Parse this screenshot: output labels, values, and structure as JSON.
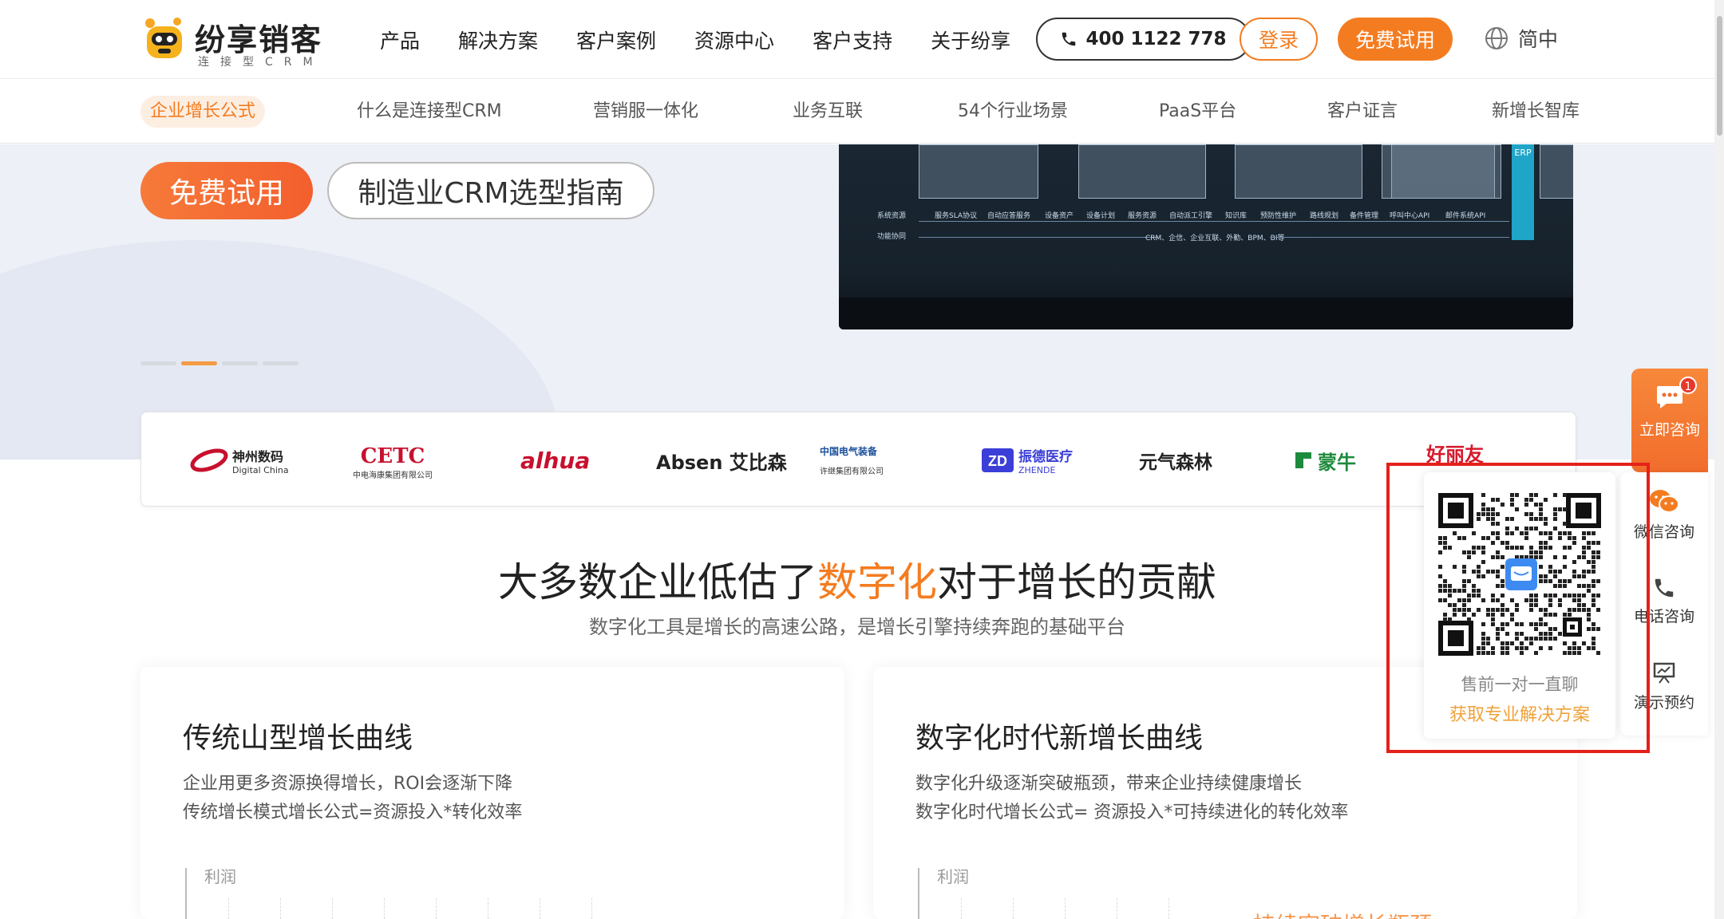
{
  "header": {
    "logo_text": "纷享销客",
    "logo_sub": "连接型CRM",
    "nav": [
      "产品",
      "解决方案",
      "客户案例",
      "资源中心",
      "客户支持",
      "关于纷享"
    ],
    "phone": "400 1122 778",
    "login": "登录",
    "trial": "免费试用",
    "lang": "简中"
  },
  "subnav": [
    "企业增长公式",
    "什么是连接型CRM",
    "营销服一体化",
    "业务互联",
    "54个行业场景",
    "PaaS平台",
    "客户证言",
    "新增长智库"
  ],
  "hero": {
    "trial_button": "免费试用",
    "guide_button": "制造业CRM选型指南",
    "image_labels": {
      "row1": "系统资源",
      "row2": "功能协同",
      "row2_center": "CRM、企信、企业互联、外勤、BPM、BI等",
      "erp": "ERP",
      "row1_items": [
        "服务SLA协议",
        "自动应答服务",
        "设备资产",
        "设备计划",
        "服务资源",
        "自动派工引擎",
        "知识库",
        "预防性维护",
        "路线规划",
        "备件管理",
        "呼叫中心API",
        "邮件系统API"
      ]
    }
  },
  "client_logos": [
    "神州数码",
    "Digital China",
    "CETC",
    "中电海康集团有限公司",
    "alhua",
    "Absen 艾比森",
    "中国电气装备",
    "许继集团有限公司",
    "振德医疗",
    "ZHENDE",
    "元气森林",
    "蒙牛",
    "好丽友"
  ],
  "section": {
    "title_before": "大多数企业低估了",
    "title_highlight": "数字化",
    "title_after": "对于增长的贡献",
    "subtitle": "数字化工具是增长的高速公路，是增长引擎持续奔跑的基础平台"
  },
  "cards": [
    {
      "title": "传统山型增长曲线",
      "line1": "企业用更多资源换得增长，ROI会逐渐下降",
      "line2": "传统增长模式增长公式=资源投入*转化效率",
      "axis_label": "利润"
    },
    {
      "title": "数字化时代新增长曲线",
      "line1": "数字化升级逐渐突破瓶颈，带来企业持续健康增长",
      "line2": "数字化时代增长公式= 资源投入*可持续进化的转化效率",
      "axis_label": "利润",
      "curve_label": "持续突破增长瓶颈"
    }
  ],
  "float": {
    "consult": "立即咨询",
    "badge": "1",
    "wechat": "微信咨询",
    "phone": "电话咨询",
    "demo": "演示预约",
    "qr_text1": "售前一对一直聊",
    "qr_text2": "获取专业解决方案"
  },
  "colors": {
    "brand": "#f47c20",
    "highlight_frame": "#e5201b"
  }
}
